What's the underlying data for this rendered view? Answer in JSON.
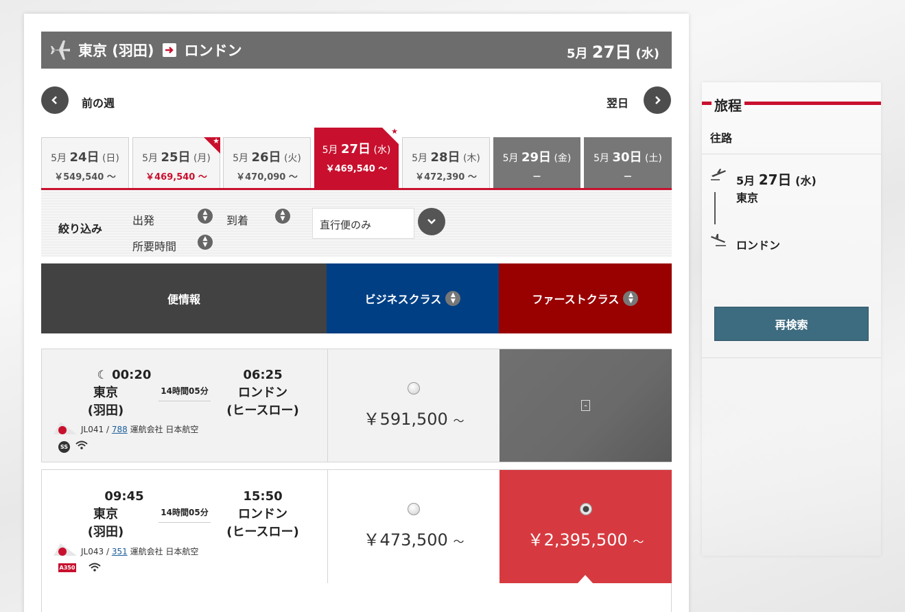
{
  "header": {
    "origin": "東京 (羽田)",
    "destination": "ロンドン",
    "date_month": "5月",
    "date_day": "27日",
    "date_weekday": "(水)"
  },
  "nav": {
    "prev_label": "前の週",
    "next_label": "翌日"
  },
  "date_tabs": [
    {
      "month": "5月",
      "day": "24日",
      "weekday": "(日)",
      "price": "￥549,540 ～"
    },
    {
      "month": "5月",
      "day": "25日",
      "weekday": "(月)",
      "price": "￥469,540 ～"
    },
    {
      "month": "5月",
      "day": "26日",
      "weekday": "(火)",
      "price": "￥470,090 ～"
    },
    {
      "month": "5月",
      "day": "27日",
      "weekday": "(水)",
      "price": "￥469,540 ～"
    },
    {
      "month": "5月",
      "day": "28日",
      "weekday": "(木)",
      "price": "￥472,390 ～"
    },
    {
      "month": "5月",
      "day": "29日",
      "weekday": "(金)",
      "price": "－"
    },
    {
      "month": "5月",
      "day": "30日",
      "weekday": "(土)",
      "price": "－"
    }
  ],
  "filter": {
    "title": "絞り込み",
    "departure": "出発",
    "arrival": "到着",
    "duration": "所要時間",
    "nonstop_select": "直行便のみ"
  },
  "columns": {
    "info": "便情報",
    "business": "ビジネスクラス",
    "first": "ファーストクラス"
  },
  "flights": [
    {
      "dep_time": "00:20",
      "dep_city": "東京",
      "dep_airport": "(羽田)",
      "duration": "14時間05分",
      "arr_time": "06:25",
      "arr_city": "ロンドン",
      "arr_airport": "(ヒースロー)",
      "flight_no": "JL041 /",
      "aircraft": "788",
      "operator": "運航会社 日本航空",
      "badge": "SS",
      "business_price": "￥591,500",
      "first_price": "-"
    },
    {
      "dep_time": "09:45",
      "dep_city": "東京",
      "dep_airport": "(羽田)",
      "duration": "14時間05分",
      "arr_time": "15:50",
      "arr_city": "ロンドン",
      "arr_airport": "(ヒースロー)",
      "flight_no": "JL043 /",
      "aircraft": "351",
      "operator": "運航会社 日本航空",
      "badge": "A350",
      "business_price": "￥473,500",
      "first_price": "￥2,395,500"
    }
  ],
  "price_suffix": "～",
  "sidebar": {
    "title": "旅程",
    "leg_label": "往路",
    "month": "5月",
    "day": "27日",
    "weekday": "(水)",
    "from": "東京",
    "to": "ロンドン",
    "research_button": "再検索"
  },
  "colors": {
    "accent_red": "#c8102e",
    "business_blue": "#003f84",
    "first_red": "#990000",
    "header_gray": "#6d6d6d"
  }
}
